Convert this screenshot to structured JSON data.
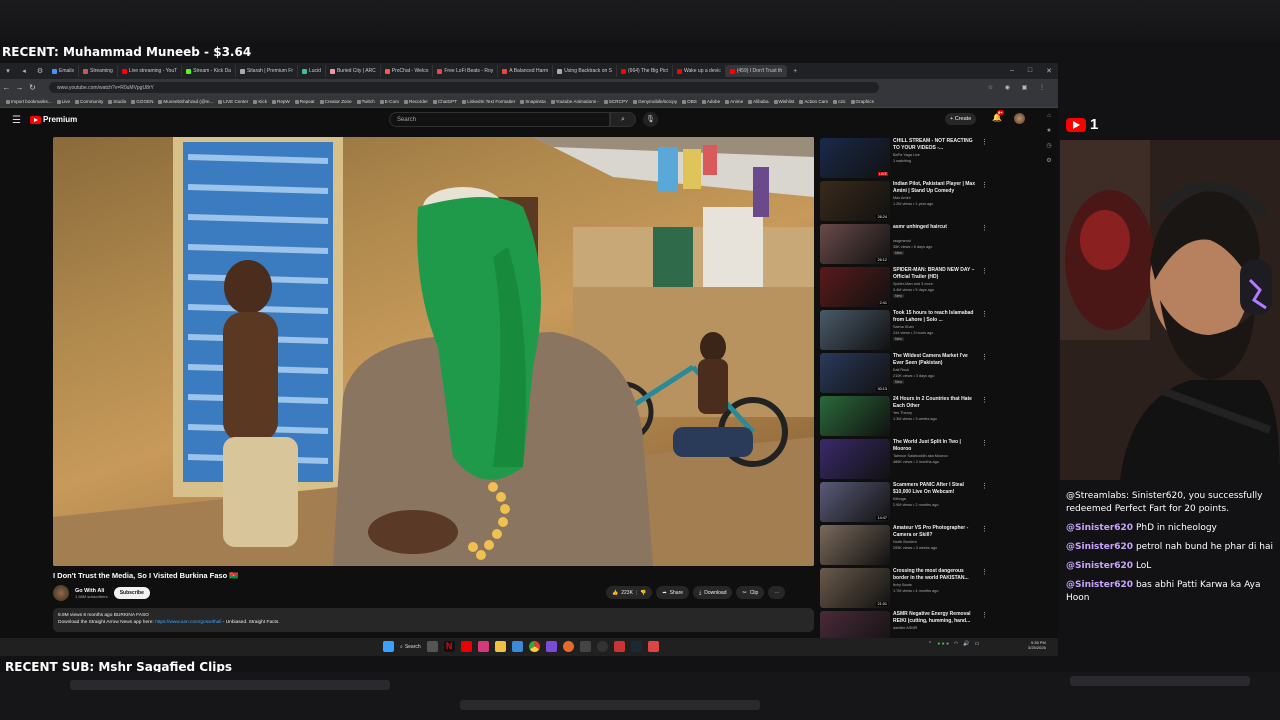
{
  "overlay": {
    "recent_donation": "RECENT: Muhammad Muneeb - $3.64",
    "recent_sub": "RECENT SUB: Mshr Sagafied Clips",
    "youtube_count": "1"
  },
  "browser": {
    "tabs": [
      {
        "label": "Emails",
        "color": "#4f8ef7"
      },
      {
        "label": "Streaming",
        "color": "#c55"
      },
      {
        "label": "Live streaming - YouT",
        "color": "#f00"
      },
      {
        "label": "Stream - Kick Da",
        "color": "#53fc18"
      },
      {
        "label": "Sitarah | Premium Fr",
        "color": "#aaa"
      },
      {
        "label": "Lucid",
        "color": "#4b9"
      },
      {
        "label": "Buried City | ARC",
        "color": "#e9a"
      },
      {
        "label": "ProChat - Welco",
        "color": "#f55"
      },
      {
        "label": "Free LoFi Beats - Roy",
        "color": "#e44"
      },
      {
        "label": "A Balanced Harm",
        "color": "#e44"
      },
      {
        "label": "Using Backtrack on S",
        "color": "#aaa"
      },
      {
        "label": "(664) The Big Pict",
        "color": "#f00"
      },
      {
        "label": "Wake up a devic",
        "color": "#f00"
      },
      {
        "label": "(459) I Don't Trust th",
        "color": "#f00"
      }
    ],
    "url": "www.youtube.com/watch?v=R0uMVpgU8rY",
    "bookmarks": [
      "Import bookmarks...",
      "Live",
      "Community",
      "Studio",
      "GGGEN",
      "MuneebShahzad (@m...",
      "LIVE Center",
      "Kick",
      "RepW",
      "Repeat",
      "Creator Zone",
      "Twitch",
      "E-Com",
      "Recorder",
      "ChatGPT",
      "LinkedIn Text Formatter",
      "Snapinsta",
      "Youtube Animations -",
      "SCRCPY",
      "Genymobile/scrcpy",
      "OBS",
      "Adobe",
      "Anime",
      "Alibaba",
      "Wishlist",
      "Action Cam",
      "c2o",
      "Graphics"
    ]
  },
  "youtube": {
    "logo_label": "Premium",
    "search_placeholder": "Search",
    "create_label": "Create",
    "notif_count": "9+",
    "video": {
      "title": "I Don't Trust the Media, So I Visited Burkina Faso 🇧🇫",
      "channel": "Go With Ali",
      "subscribers": "1.58M subscribers",
      "subscribe_label": "Subscribe",
      "likes": "223K",
      "share_label": "Share",
      "download_label": "Download",
      "clip_label": "Clip",
      "description_meta": "8.9M views  8 months ago  BURKINA FASO",
      "description_text": "Download the Straight Arrow News app here: ",
      "description_link": "https://www.san.com/goswithali",
      "description_tail": " - Unbiased. Straight Facts."
    },
    "recommendations": [
      {
        "title": "CHILL STREAM - NOT REACTING TO YOUR VIDEOS -...",
        "channel": "BaPa Yaga Live",
        "meta": "1 watching",
        "badge": "",
        "duration": "LIVE",
        "thumb": "#1a2a4a"
      },
      {
        "title": "Indian Pilot, Pakistani Player | Max Amini | Stand Up Comedy",
        "channel": "Max Amini",
        "meta": "1.2M views • 1 year ago",
        "badge": "",
        "duration": "26:24",
        "thumb": "#3a2a1a"
      },
      {
        "title": "asmr unhinged haircut",
        "channel": "rasgmenol",
        "meta": "35K views • 6 days ago",
        "badge": "New",
        "duration": "26:12",
        "thumb": "#6a4a4a"
      },
      {
        "title": "SPIDER-MAN: BRAND NEW DAY – Official Trailer (HD)",
        "channel": "Spider-Man and 3 more",
        "meta": "3.4M views • 5 days ago",
        "badge": "New",
        "duration": "2:41",
        "thumb": "#5a1a1a"
      },
      {
        "title": "Took 15 hours to reach Islamabad from Lahore | Solo ...",
        "channel": "Saima Khan",
        "meta": "244 views • 3 hours ago",
        "badge": "New",
        "duration": "",
        "thumb": "#4a5a6a"
      },
      {
        "title": "The Wildest Camera Market I've Ever Seen (Pakistan)",
        "channel": "Kali Rock",
        "meta": "210K views • 3 days ago",
        "badge": "New",
        "duration": "30:13",
        "thumb": "#2a3a5a"
      },
      {
        "title": "24 Hours in 2 Countries that Hate Each Other",
        "channel": "Yes Theory",
        "meta": "1.3M views • 3 weeks ago",
        "badge": "",
        "duration": "",
        "thumb": "#2a6a3a"
      },
      {
        "title": "The World Just Split In Two | Moorоо",
        "channel": "Taimoor Salahuddin aka Mooroo",
        "meta": "486K views • 2 months ago",
        "badge": "",
        "duration": "",
        "thumb": "#3a2a6a"
      },
      {
        "title": "Scammers PANIC After I Steal $10,000 Live On Webcam!",
        "channel": "Kitboga",
        "meta": "2.9M views • 2 months ago",
        "badge": "",
        "duration": "14:47",
        "thumb": "#5a5a7a"
      },
      {
        "title": "Amateur VS Pro Photographer - Camera or Skill?",
        "channel": "North Borders",
        "meta": "295K views • 3 weeks ago",
        "badge": "",
        "duration": "",
        "thumb": "#7a6a5a"
      },
      {
        "title": "Crossing the most dangerous border in the world  PAKISTAN...",
        "channel": "Itchy Boots",
        "meta": "1.7M views • 4 months ago",
        "badge": "",
        "duration": "21:01",
        "thumb": "#6a5a4a"
      },
      {
        "title": "ASMR Negative Energy Removal REIKI (cutting, humming, hand...",
        "channel": "darkitte ASMR",
        "meta": "",
        "badge": "",
        "duration": "",
        "thumb": "#4a2a3a"
      }
    ]
  },
  "taskbar": {
    "search_label": "Search",
    "time": "9:35 PM",
    "date": "3/25/2026"
  },
  "chat": {
    "redeem_text": "@Streamlabs: Sinister620, you successfully redeemed Perfect Fart for 20 points.",
    "messages": [
      {
        "user": "@Sinister620",
        "text": "PhD in nicheology"
      },
      {
        "user": "@Sinister620",
        "text": "petrol nah bund he phar di hai"
      },
      {
        "user": "@Sinister620",
        "text": "LoL"
      },
      {
        "user": "@Sinister620",
        "text": "bas abhi Patti Karwa ka Aya Hoon"
      }
    ]
  }
}
